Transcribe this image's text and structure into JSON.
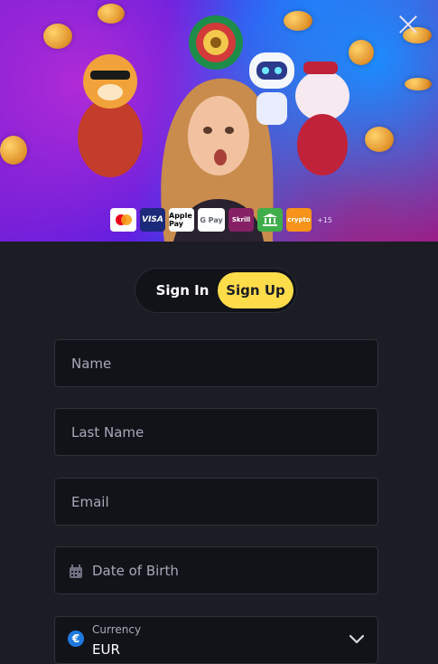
{
  "banner": {
    "payment_methods": [
      "Mastercard",
      "VISA",
      "Apple Pay",
      "G Pay",
      "Skrill",
      "Bank",
      "crypto"
    ],
    "payment_more": "+15"
  },
  "auth_tabs": {
    "sign_in": "Sign In",
    "sign_up": "Sign Up",
    "active": "Sign Up"
  },
  "form": {
    "name_placeholder": "Name",
    "last_name_placeholder": "Last Name",
    "email_placeholder": "Email",
    "dob_placeholder": "Date of Birth",
    "currency": {
      "label": "Currency",
      "value": "EUR",
      "symbol": "€"
    }
  },
  "colors": {
    "background": "#1b1c24",
    "accent": "#ffdc4a",
    "field_bg": "#121319",
    "field_border": "#30313b"
  }
}
